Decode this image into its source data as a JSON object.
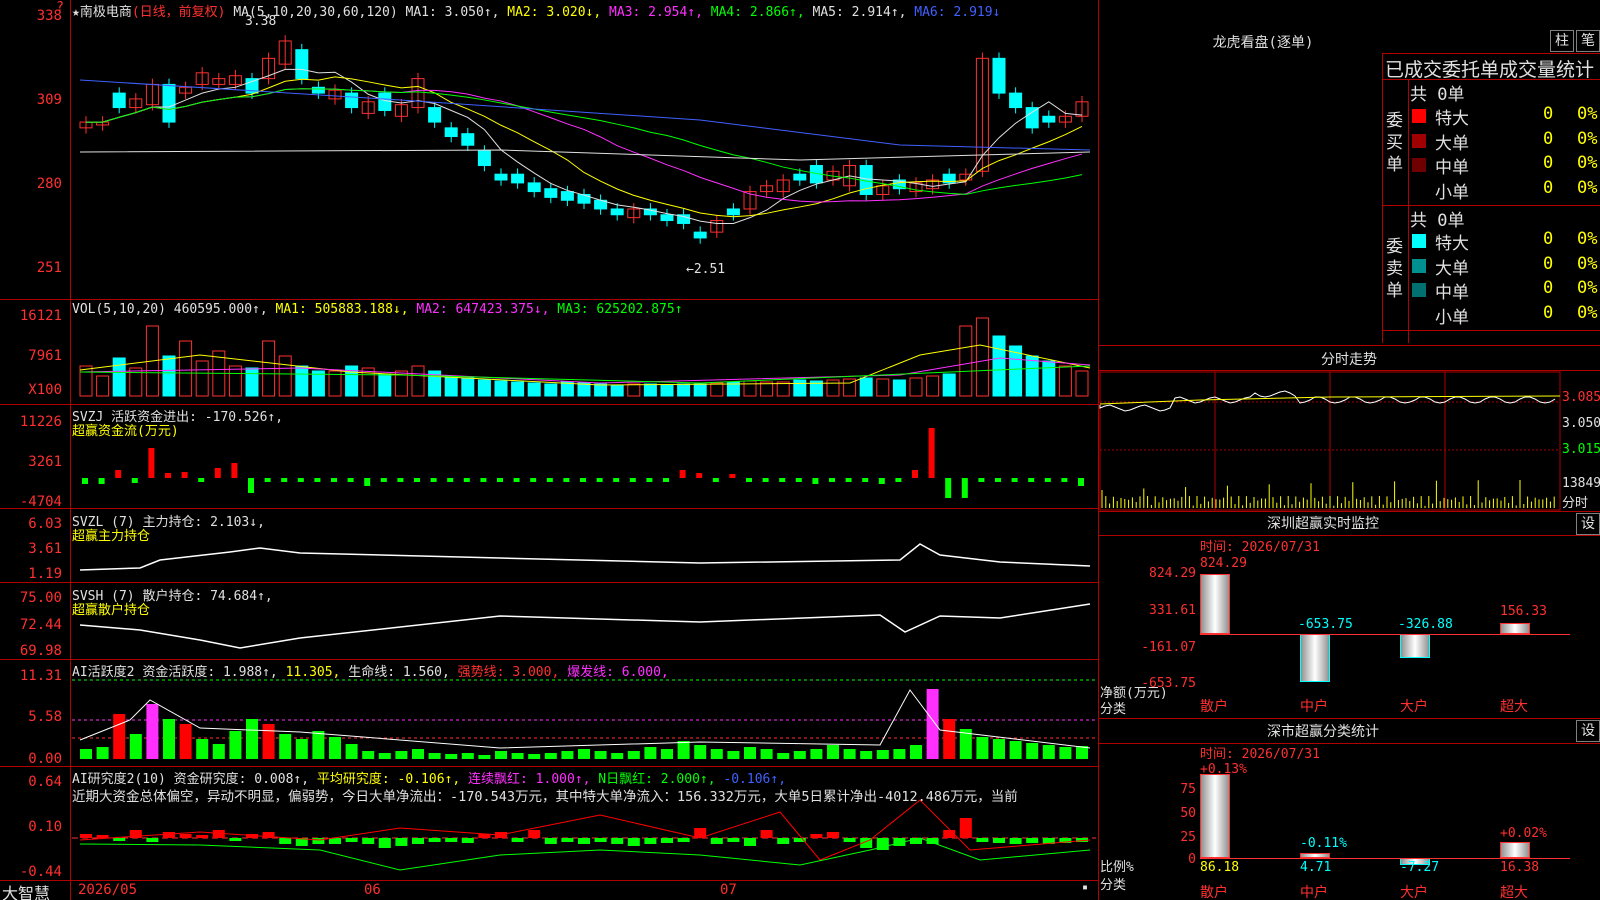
{
  "stock": {
    "star": "★",
    "name": "南极电商",
    "period": "(日线，前复权)"
  },
  "main_legend": {
    "ma_label": "MA(5,10,20,30,60,120)",
    "items": [
      {
        "text": "MA1: 3.050↑,",
        "color": "#e0e0e0"
      },
      {
        "text": "MA2: 3.020↓,",
        "color": "#ffff00"
      },
      {
        "text": "MA3: 2.954↑,",
        "color": "#ff30ff"
      },
      {
        "text": "MA4: 2.866↑,",
        "color": "#00ff00"
      },
      {
        "text": "MA5: 2.914↑,",
        "color": "#e0e0e0"
      },
      {
        "text": "MA6: 2.919↓",
        "color": "#4060ff"
      }
    ]
  },
  "main_axis": [
    "3.38",
    "3.09",
    "2.80",
    "2.51"
  ],
  "main_axis_shown": [
    "338",
    "309",
    "280",
    "251"
  ],
  "high_note": "3.38",
  "low_note": "←2.51",
  "vol": {
    "label": "VOL(5,10,20)",
    "value": "460595.000↑,",
    "ma1": "MA1: 505883.188↓,",
    "ma2": "MA2: 647423.375↓,",
    "ma3": "MA3: 625202.875↑",
    "axis": [
      "16121",
      "7961",
      "X100"
    ]
  },
  "svzj": {
    "label": "SVZJ",
    "title": "活跃资金进出: -170.526↑,",
    "subtitle": "超赢资金流(万元)",
    "axis": [
      "11226",
      "3261",
      "-4704"
    ]
  },
  "svzl": {
    "label": "SVZL (7)",
    "title": "主力持仓: 2.103↓,",
    "subtitle": "超赢主力持仓",
    "axis": [
      "6.03",
      "3.61",
      "1.19"
    ]
  },
  "svsh": {
    "label": "SVSH (7)",
    "title": "散户持仓: 74.684↑,",
    "subtitle": "超赢散户持仓",
    "axis": [
      "75.00",
      "72.44",
      "69.98"
    ]
  },
  "ai1": {
    "label": "AI活跃度2",
    "v1": "资金活跃度: 1.988↑,",
    "v2": "11.305,",
    "v3": "生命线: 1.560,",
    "v4": "强势线: 3.000,",
    "v5": "爆发线: 6.000,",
    "axis": [
      "11.31",
      "5.58",
      "0.00"
    ]
  },
  "ai2": {
    "label": "AI研究度2(10)",
    "v1": "资金研究度: 0.008↑,",
    "v2": "平均研究度: -0.106↑,",
    "v3": "连续飘红: 1.000↑,",
    "v4": "N日飘红: 2.000↑,",
    "v5": "-0.106↑,",
    "axis": [
      "0.64",
      "0.10",
      "-0.44"
    ],
    "summary": "近期大资金总体偏空，异动不明显，偏弱势，今日大单净流出：-170.543万元，其中特大单净流入：156.332万元，大单5日累计净出-4012.486万元，当前"
  },
  "date_axis": {
    "brand": "大智慧",
    "labels": [
      "2026/05",
      "06",
      "07"
    ]
  },
  "lhb": {
    "title": "龙虎看盘(逐单)",
    "btn1": "柱",
    "btn2": "笔",
    "subtitle": "已成交委托单成交量统计",
    "buy_side": "委买单",
    "sell_side": "委卖单",
    "buy_total": "共 0单",
    "sell_total": "共 0单",
    "buy_rows": [
      {
        "label": "特大",
        "count": "0",
        "pct": "0%",
        "color": "#ff0000"
      },
      {
        "label": "大单",
        "count": "0",
        "pct": "0%",
        "color": "#a00000"
      },
      {
        "label": "中单",
        "count": "0",
        "pct": "0%",
        "color": "#700000"
      },
      {
        "label": "小单",
        "count": "0",
        "pct": "0%",
        "color": ""
      }
    ],
    "sell_rows": [
      {
        "label": "特大",
        "count": "0",
        "pct": "0%",
        "color": "#00ffff"
      },
      {
        "label": "大单",
        "count": "0",
        "pct": "0%",
        "color": "#009090"
      },
      {
        "label": "中单",
        "count": "0",
        "pct": "0%",
        "color": "#007070"
      },
      {
        "label": "小单",
        "count": "0",
        "pct": "0%",
        "color": ""
      }
    ]
  },
  "fenshi": {
    "title": "分时走势",
    "axis": [
      "3.085",
      "3.050",
      "3.015"
    ],
    "vol_axis": [
      "13849",
      "分时"
    ]
  },
  "monitor": {
    "title": "深圳超赢实时监控",
    "btn": "设",
    "time": "时间: 2026/07/31",
    "axis": [
      "824.29",
      "331.61",
      "-161.07",
      "-653.75"
    ],
    "unit_label": "净额(万元)",
    "cat_label": "分类",
    "categories": [
      "散户",
      "中户",
      "大户",
      "超大"
    ],
    "values": [
      824.29,
      -653.75,
      -326.88,
      156.33
    ],
    "value_labels": [
      "824.29",
      "-653.75",
      "-326.88",
      "156.33"
    ]
  },
  "ratio": {
    "title": "深市超赢分类统计",
    "btn": "设",
    "time": "时间: 2026/07/31",
    "axis": [
      "75",
      "50",
      "25",
      "0"
    ],
    "unit_label": "比例%",
    "cat_label": "分类",
    "categories": [
      "散户",
      "中户",
      "大户",
      "超大"
    ],
    "values": [
      86.18,
      4.71,
      -7.27,
      16.38
    ],
    "top_labels": [
      "+0.13%",
      "-0.11%",
      "",
      "+0.02%"
    ],
    "bottom_labels": [
      "86.18",
      "4.71",
      "-7.27",
      "16.38"
    ]
  }
}
